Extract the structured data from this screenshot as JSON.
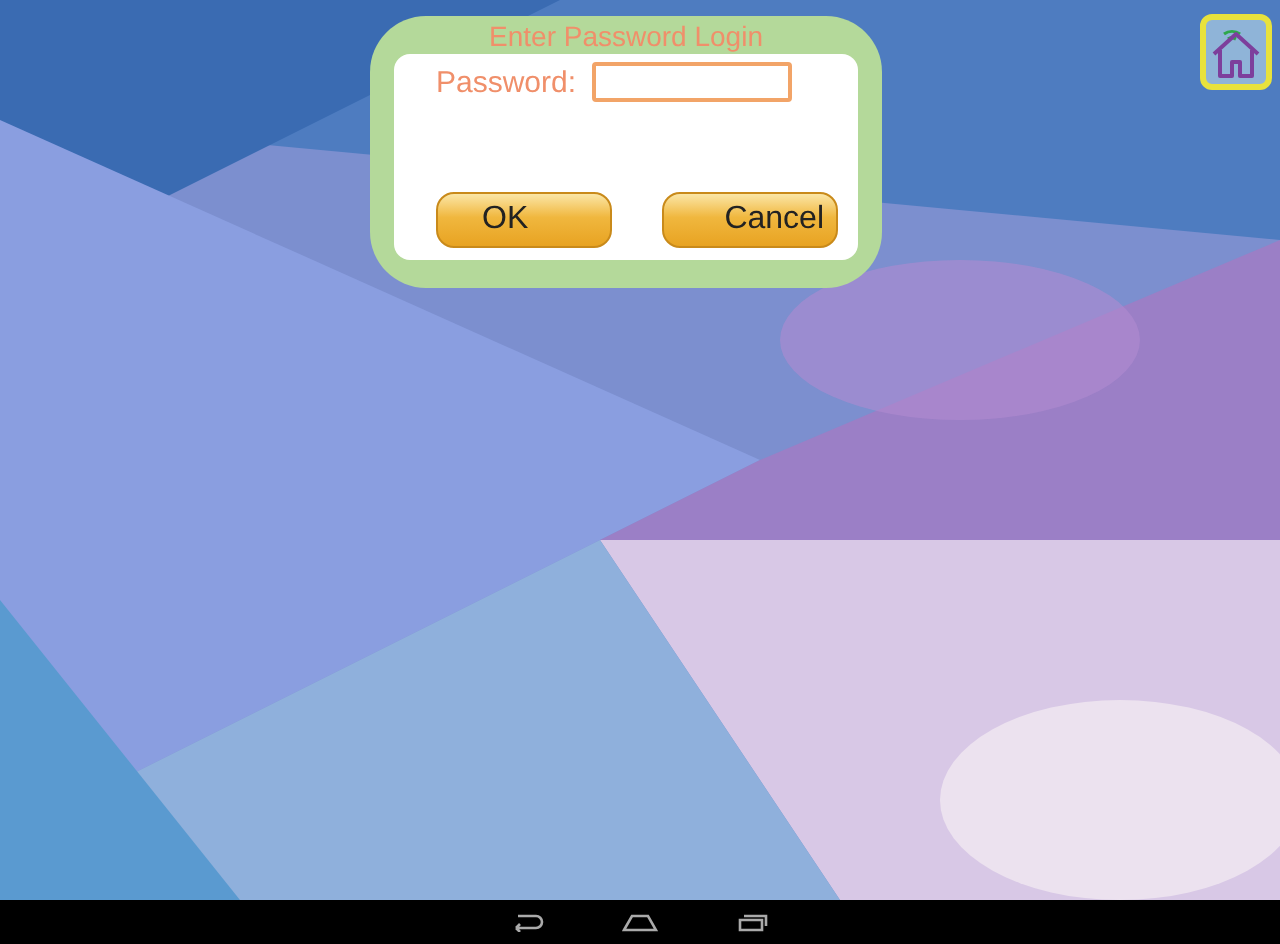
{
  "dialog": {
    "title": "Enter Password Login",
    "password_label": "Password:",
    "buttons": [
      "OK",
      "Cancel"
    ]
  }
}
